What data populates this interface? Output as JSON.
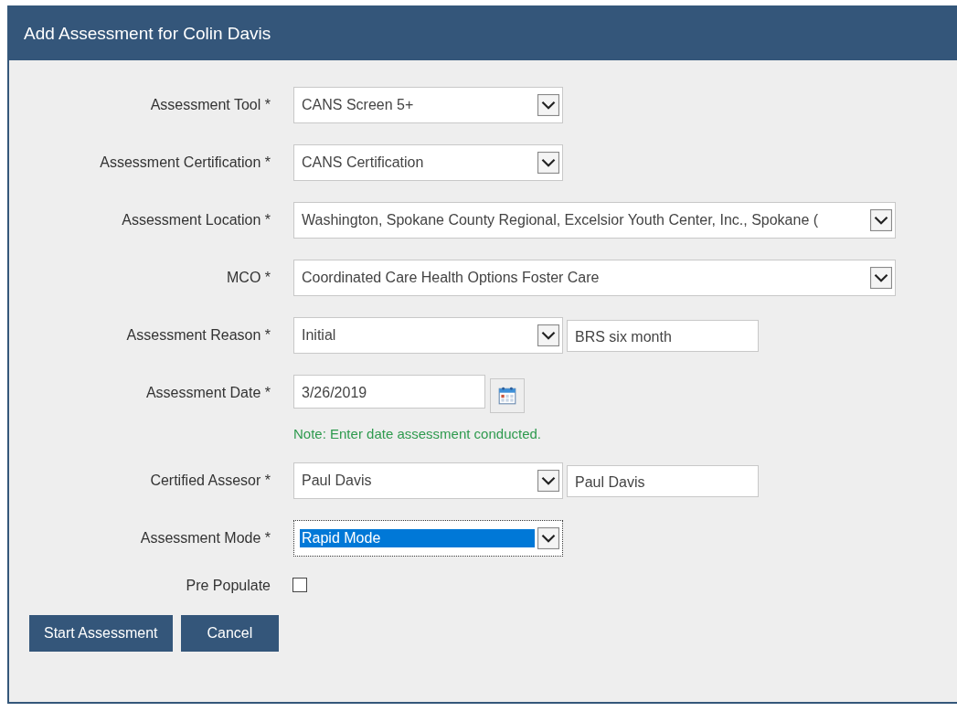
{
  "dialog": {
    "title": "Add Assessment for Colin Davis"
  },
  "fields": [
    {
      "kind": "select",
      "label": "Assessment Tool *",
      "value": "CANS Screen 5+",
      "focused": false
    },
    {
      "kind": "select",
      "label": "Assessment Certification *",
      "value": "CANS Certification",
      "focused": false
    },
    {
      "kind": "select",
      "label": "Assessment Location *",
      "value": "Washington, Spokane County Regional, Excelsior Youth Center, Inc., Spokane (",
      "focused": false
    },
    {
      "kind": "select",
      "label": "MCO *",
      "value": "Coordinated Care Health Options Foster Care",
      "focused": false
    },
    {
      "kind": "select",
      "label": "Assessment Reason *",
      "value": "Initial",
      "focused": false,
      "extra": "BRS six month"
    },
    {
      "kind": "date",
      "label": "Assessment Date *",
      "value": "3/26/2019",
      "note": "Note: Enter date assessment conducted."
    },
    {
      "kind": "select",
      "label": "Certified Assesor *",
      "value": "Paul Davis",
      "focused": false,
      "extra": "Paul Davis"
    },
    {
      "kind": "select",
      "label": "Assessment Mode *",
      "value": "Rapid Mode",
      "focused": true
    },
    {
      "kind": "checkbox",
      "label": "Pre Populate",
      "checked": false
    }
  ],
  "buttons": [
    "Start Assessment",
    "Cancel"
  ]
}
